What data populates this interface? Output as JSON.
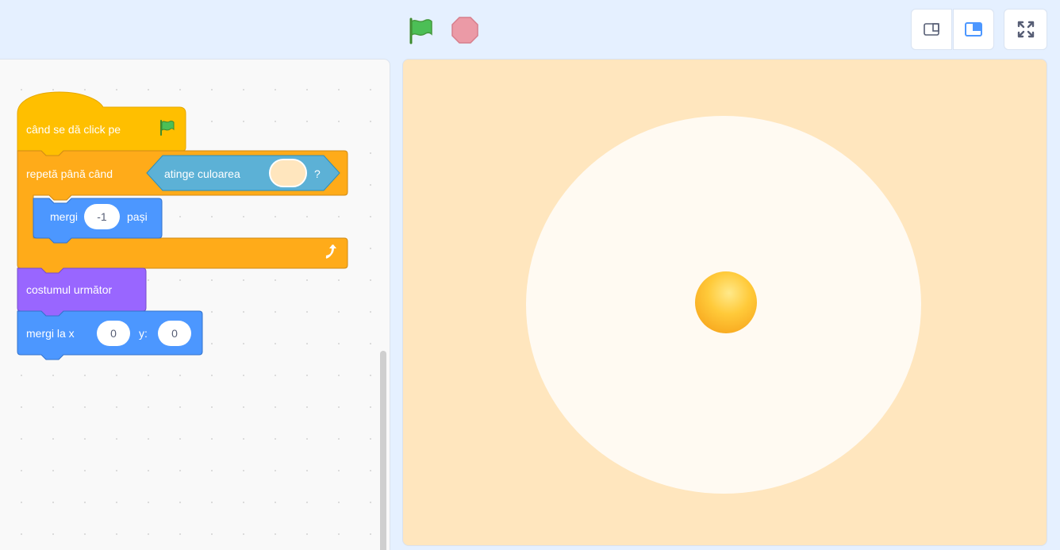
{
  "controls": {
    "green_flag_icon": "green-flag-icon",
    "stop_icon": "stop-icon",
    "small_stage_icon": "small-stage-icon",
    "normal_stage_icon": "normal-stage-icon",
    "fullscreen_icon": "fullscreen-icon"
  },
  "script": {
    "hat": {
      "label": "când se dă click pe",
      "color": "#ffbf00"
    },
    "repeat_until": {
      "label": "repetă până când",
      "color": "#ffab19",
      "condition": {
        "label": "atinge culoarea",
        "suffix": "?",
        "color_value": "#ffe6be",
        "block_color": "#5cb1d6"
      }
    },
    "move": {
      "label": "mergi",
      "value": "-1",
      "suffix": "pași",
      "color": "#4c97ff"
    },
    "next_costume": {
      "label": "costumul următor",
      "color": "#9966ff"
    },
    "goto": {
      "label": "mergi la x",
      "x": "0",
      "y_label": "y:",
      "y": "0",
      "color": "#4c97ff"
    }
  },
  "stage": {
    "background": "#ffe6be",
    "circle_color": "#fffaf2",
    "sprite": "yellow-ball"
  }
}
